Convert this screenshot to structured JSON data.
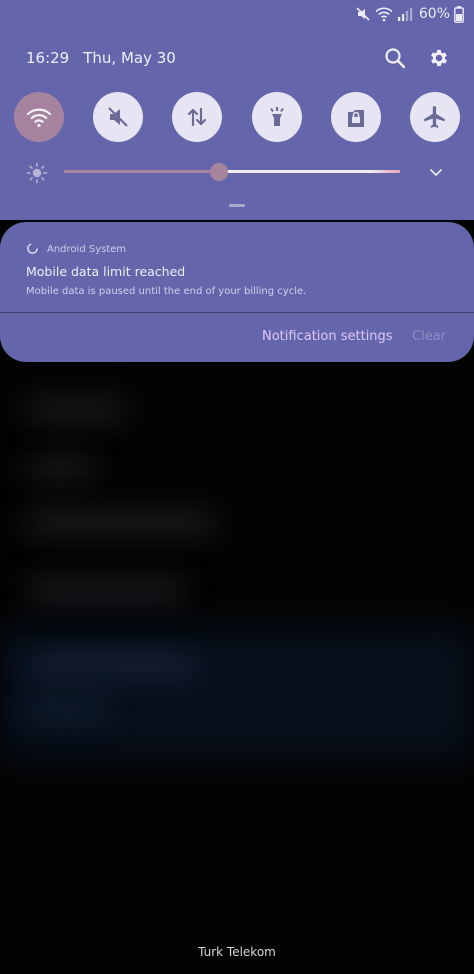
{
  "status_bar": {
    "battery_percent": "60%",
    "icons": [
      "mute-icon",
      "wifi-icon",
      "signal-icon",
      "battery-icon"
    ]
  },
  "header": {
    "time": "16:29",
    "date": "Thu, May 30",
    "actions": [
      "search-icon",
      "gear-icon"
    ]
  },
  "quick_tiles": [
    {
      "name": "wifi",
      "icon": "wifi-icon",
      "active": true
    },
    {
      "name": "sound",
      "icon": "mute-icon",
      "active": false
    },
    {
      "name": "mobile-data",
      "icon": "data-arrows-icon",
      "active": false
    },
    {
      "name": "flashlight",
      "icon": "flashlight-icon",
      "active": false
    },
    {
      "name": "secure-folder",
      "icon": "lock-icon",
      "active": false
    },
    {
      "name": "airplane-mode",
      "icon": "airplane-icon",
      "active": false
    }
  ],
  "brightness": {
    "level": 0.46,
    "icon": "sun-icon",
    "expand_icon": "chevron-down-icon"
  },
  "notification": {
    "app_name": "Android System",
    "title": "Mobile data limit reached",
    "body": "Mobile data is paused until the end of your billing cycle.",
    "settings_label": "Notification settings",
    "clear_label": "Clear"
  },
  "carrier": "Turk Telekom",
  "colors": {
    "panel": "#6465ab",
    "tile_inactive": "#e7e5f3",
    "tile_active": "#a5839f",
    "accent": "#dcc9ff"
  }
}
